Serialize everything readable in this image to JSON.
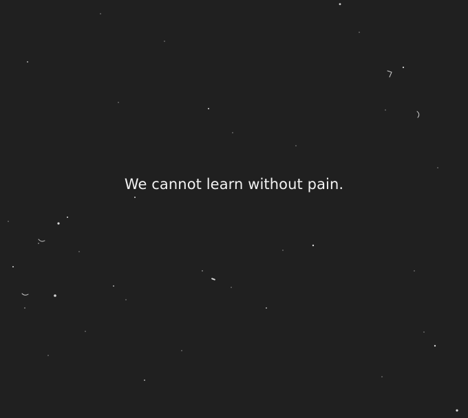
{
  "quote": {
    "text": "We cannot learn without pain."
  },
  "colors": {
    "background": "#202020",
    "text": "#f2f2f2",
    "specks": "#d8d8d8"
  }
}
